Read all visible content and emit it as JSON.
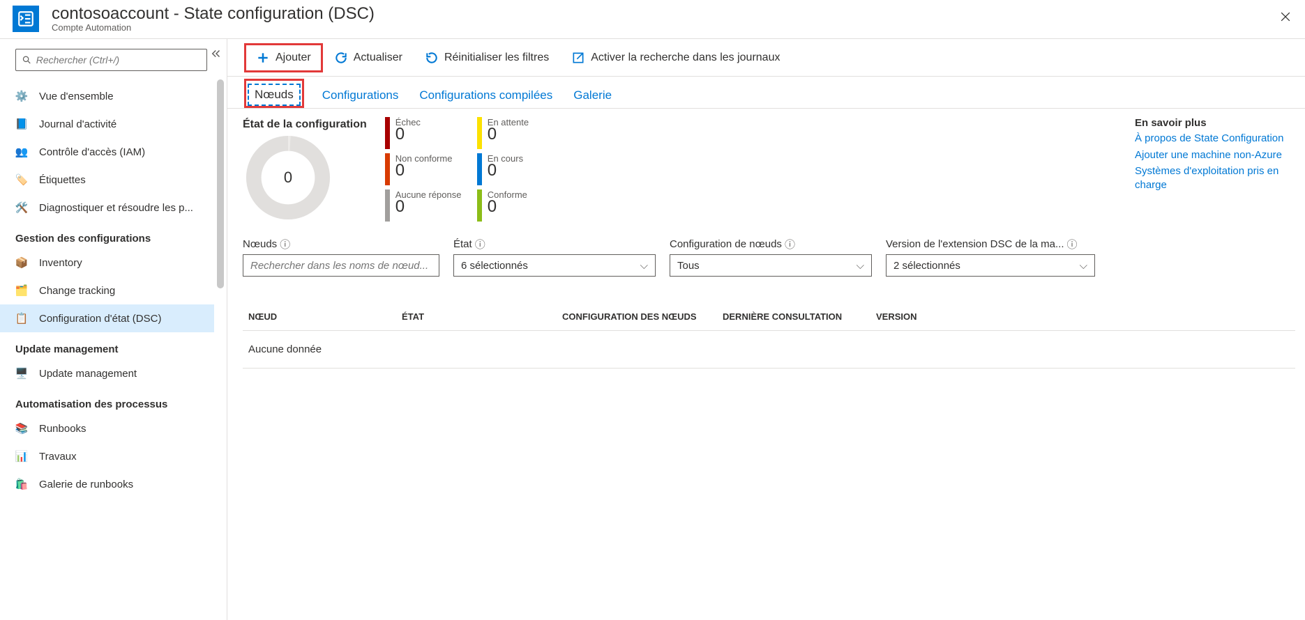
{
  "header": {
    "title": "contosoaccount - State configuration (DSC)",
    "subtitle": "Compte Automation"
  },
  "sidebar": {
    "search_placeholder": "Rechercher (Ctrl+/)",
    "items": [
      {
        "label": "Vue d'ensemble"
      },
      {
        "label": "Journal d'activité"
      },
      {
        "label": "Contrôle d'accès (IAM)"
      },
      {
        "label": "Étiquettes"
      },
      {
        "label": "Diagnostiquer et résoudre les p..."
      }
    ],
    "section_config": "Gestion des configurations",
    "config_items": [
      {
        "label": "Inventory"
      },
      {
        "label": "Change tracking"
      },
      {
        "label": "Configuration d'état (DSC)"
      }
    ],
    "section_update": "Update management",
    "update_items": [
      {
        "label": "Update management"
      }
    ],
    "section_process": "Automatisation des processus",
    "process_items": [
      {
        "label": "Runbooks"
      },
      {
        "label": "Travaux"
      },
      {
        "label": "Galerie de runbooks"
      }
    ]
  },
  "toolbar": {
    "add": "Ajouter",
    "refresh": "Actualiser",
    "reset": "Réinitialiser les filtres",
    "logsearch": "Activer la recherche dans les journaux"
  },
  "tabs": {
    "nodes": "Nœuds",
    "configs": "Configurations",
    "compiled": "Configurations compilées",
    "gallery": "Galerie"
  },
  "status": {
    "title": "État de la configuration",
    "center": "0",
    "metrics": {
      "echec": {
        "label": "Échec",
        "value": "0"
      },
      "attente": {
        "label": "En attente",
        "value": "0"
      },
      "nonconf": {
        "label": "Non conforme",
        "value": "0"
      },
      "encours": {
        "label": "En cours",
        "value": "0"
      },
      "noresp": {
        "label": "Aucune réponse",
        "value": "0"
      },
      "conforme": {
        "label": "Conforme",
        "value": "0"
      }
    }
  },
  "learn_more": {
    "heading": "En savoir plus",
    "link1": "À propos de State Configuration",
    "link2": "Ajouter une machine non-Azure",
    "link3": "Systèmes d'exploitation pris en charge"
  },
  "filters": {
    "nodes_label": "Nœuds",
    "nodes_placeholder": "Rechercher dans les noms de nœud...",
    "state_label": "État",
    "state_value": "6 sélectionnés",
    "nodeconf_label": "Configuration de nœuds",
    "nodeconf_value": "Tous",
    "dsc_label": "Version de l'extension DSC de la ma...",
    "dsc_value": "2 sélectionnés"
  },
  "table": {
    "col_node": "NŒUD",
    "col_state": "ÉTAT",
    "col_config": "CONFIGURATION DES NŒUDS",
    "col_last": "DERNIÈRE CONSULTATION",
    "col_version": "VERSION",
    "empty": "Aucune donnée"
  }
}
